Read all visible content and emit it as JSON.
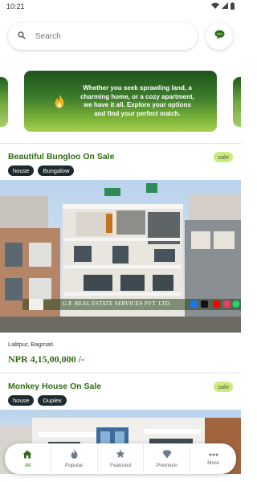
{
  "status_bar": {
    "time": "10:21"
  },
  "search": {
    "placeholder": "Search"
  },
  "banner": {
    "text": "Whether you seek sprawling land, a charming home, or a cozy apartment, we have it all. Explore your options and find your perfect match."
  },
  "listings": [
    {
      "title": "Beautiful Bungloo On Sale",
      "badge": "sale",
      "tags": [
        "house",
        "Bungalow"
      ],
      "watermark": "G.P. REAL ESTATE SERVICES PVT. LTD.",
      "location": "Lalitpur, Bagmati",
      "price": "NPR 4,15,00,000 /-"
    },
    {
      "title": "Monkey House On Sale",
      "badge": "sale",
      "tags": [
        "house",
        "Duplex"
      ]
    }
  ],
  "nav": {
    "items": [
      {
        "label": "All",
        "icon": "home-icon"
      },
      {
        "label": "Popular",
        "icon": "fire-icon"
      },
      {
        "label": "Featured",
        "icon": "star-icon"
      },
      {
        "label": "Premium",
        "icon": "diamond-icon"
      },
      {
        "label": "More",
        "icon": "more-icon"
      }
    ]
  },
  "colors": {
    "brand_green": "#2f6c14",
    "badge_green": "#c9ec7b",
    "tag_dark": "#1d2b2e"
  }
}
